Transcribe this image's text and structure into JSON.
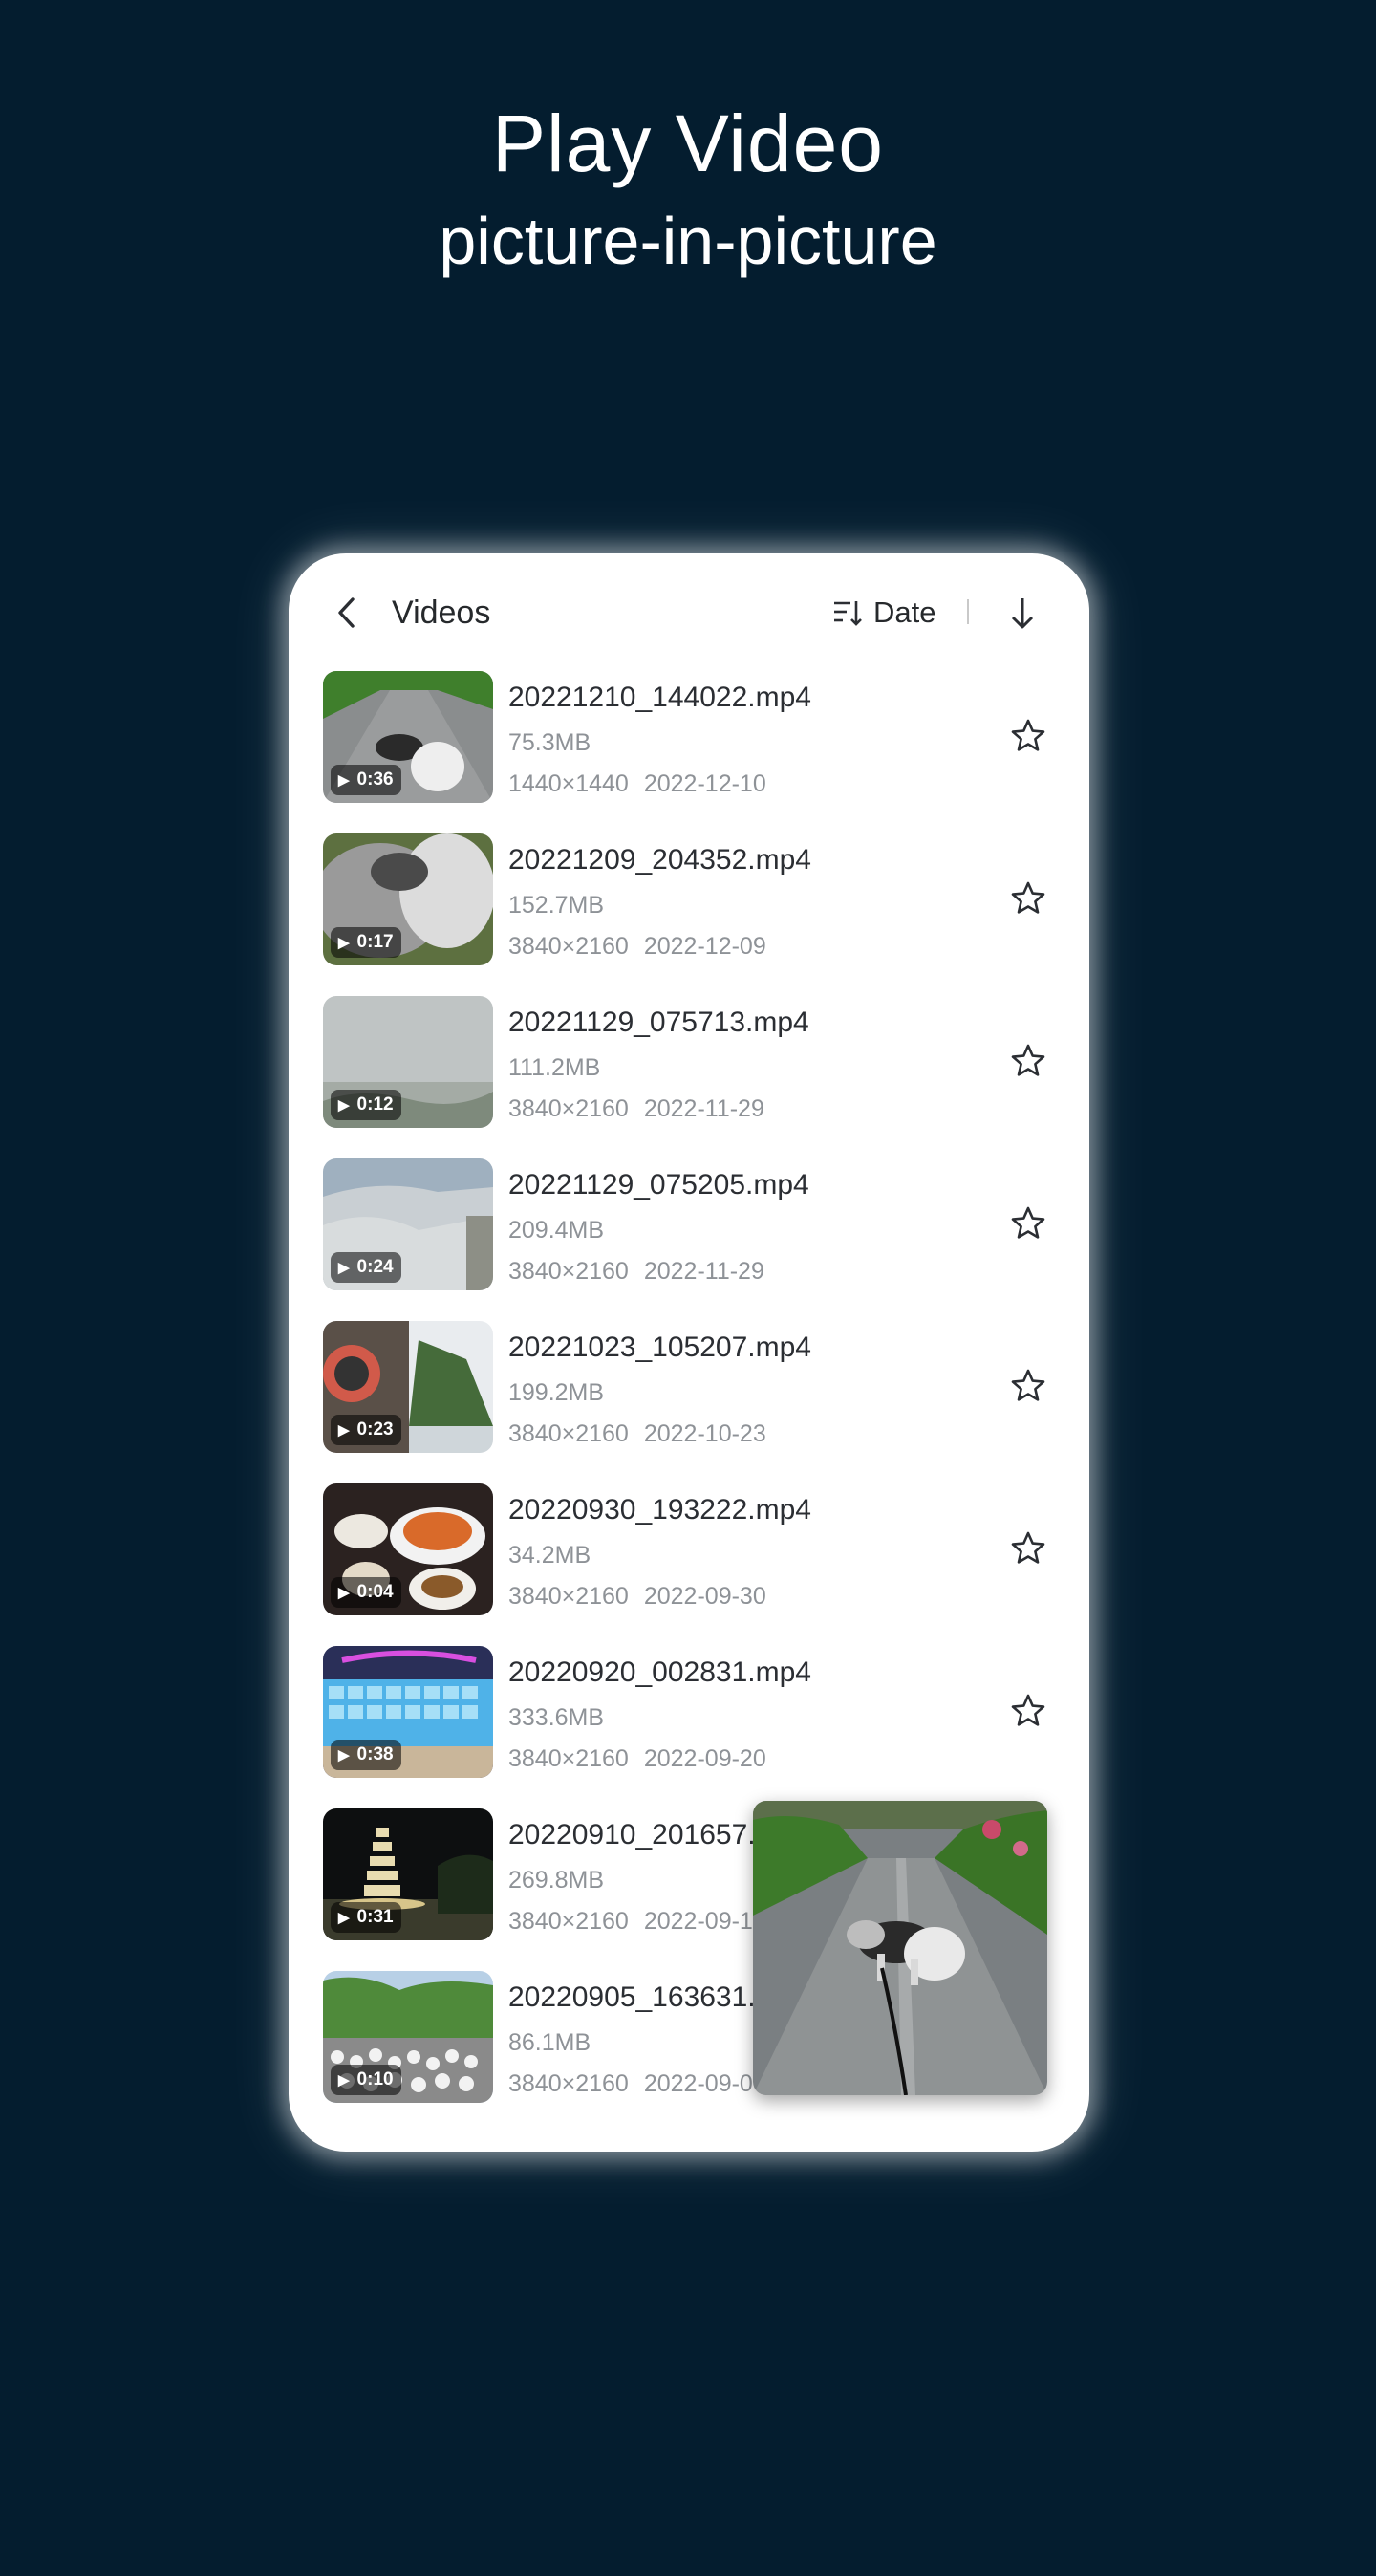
{
  "promo": {
    "headline": "Play Video",
    "subheadline": "picture-in-picture"
  },
  "appbar": {
    "title": "Videos",
    "sort_label": "Date"
  },
  "videos": [
    {
      "name": "20221210_144022.mp4",
      "size": "75.3MB",
      "resolution": "1440×1440",
      "date": "2022-12-10",
      "duration": "0:36",
      "thumb": "dog-road"
    },
    {
      "name": "20221209_204352.mp4",
      "size": "152.7MB",
      "resolution": "3840×2160",
      "date": "2022-12-09",
      "duration": "0:17",
      "thumb": "fur-closeup"
    },
    {
      "name": "20221129_075713.mp4",
      "size": "111.2MB",
      "resolution": "3840×2160",
      "date": "2022-11-29",
      "duration": "0:12",
      "thumb": "fog"
    },
    {
      "name": "20221129_075205.mp4",
      "size": "209.4MB",
      "resolution": "3840×2160",
      "date": "2022-11-29",
      "duration": "0:24",
      "thumb": "fog-mountain"
    },
    {
      "name": "20221023_105207.mp4",
      "size": "199.2MB",
      "resolution": "3840×2160",
      "date": "2022-10-23",
      "duration": "0:23",
      "thumb": "cliff"
    },
    {
      "name": "20220930_193222.mp4",
      "size": "34.2MB",
      "resolution": "3840×2160",
      "date": "2022-09-30",
      "duration": "0:04",
      "thumb": "food"
    },
    {
      "name": "20220920_002831.mp4",
      "size": "333.6MB",
      "resolution": "3840×2160",
      "date": "2022-09-20",
      "duration": "0:38",
      "thumb": "keyboard"
    },
    {
      "name": "20220910_201657.",
      "size": "269.8MB",
      "resolution": "3840×2160",
      "date": "2022-09-1",
      "duration": "0:31",
      "thumb": "pagoda-night"
    },
    {
      "name": "20220905_163631.",
      "size": "86.1MB",
      "resolution": "3840×2160",
      "date": "2022-09-0",
      "duration": "0:10",
      "thumb": "crowd"
    }
  ],
  "icons": {
    "back": "chevron-left-icon",
    "sort": "sort-icon",
    "order": "arrow-down-icon",
    "favorite": "star-outline-icon",
    "play": "play-icon"
  },
  "colors": {
    "background": "#041d2f",
    "card": "#ffffff",
    "primary_text": "#2b2e33",
    "secondary_text": "#8e9297"
  }
}
